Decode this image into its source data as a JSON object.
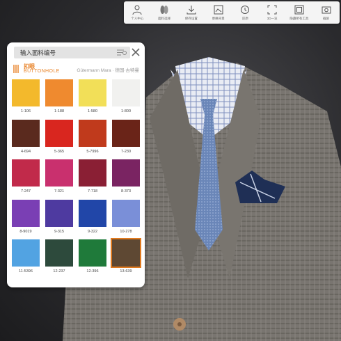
{
  "toolbar": {
    "items": [
      {
        "label": "个人中心",
        "icon": "user-icon"
      },
      {
        "label": "面料选择",
        "icon": "fabric-icon"
      },
      {
        "label": "保存设置",
        "icon": "download-icon"
      },
      {
        "label": "更换背景",
        "icon": "background-icon"
      },
      {
        "label": "还原",
        "icon": "history-icon"
      },
      {
        "label": "3D一览",
        "icon": "fullscreen-icon"
      },
      {
        "label": "隐藏所有工具",
        "icon": "hide-tools-icon"
      },
      {
        "label": "截屏",
        "icon": "camera-icon"
      }
    ]
  },
  "panel": {
    "search_placeholder": "输入面料编号",
    "brand_cn": "扣眼",
    "brand_en": "BUTTONHOLE",
    "brand_right": "Gütermann Mara · 德国·古特曼",
    "accent": "#e8842a",
    "swatches": [
      {
        "code": "1-106",
        "color": "#f3b92c"
      },
      {
        "code": "1-188",
        "color": "#ef8a2f"
      },
      {
        "code": "1-580",
        "color": "#f2df58"
      },
      {
        "code": "1-800",
        "color": "#f1f1ef"
      },
      {
        "code": "4-694",
        "color": "#5a2a1e"
      },
      {
        "code": "5-365",
        "color": "#d9261f"
      },
      {
        "code": "5-7996",
        "color": "#c03a1c"
      },
      {
        "code": "7-230",
        "color": "#6a2418"
      },
      {
        "code": "7-247",
        "color": "#c12a4a"
      },
      {
        "code": "7-321",
        "color": "#c9306e"
      },
      {
        "code": "7-718",
        "color": "#8a1f34"
      },
      {
        "code": "8-373",
        "color": "#7a2462"
      },
      {
        "code": "8-9019",
        "color": "#7a3fb4"
      },
      {
        "code": "9-315",
        "color": "#4e3aa0"
      },
      {
        "code": "9-322",
        "color": "#2146a8"
      },
      {
        "code": "10-278",
        "color": "#7a8fd8"
      },
      {
        "code": "11-5396",
        "color": "#52a3e2"
      },
      {
        "code": "12-237",
        "color": "#2d4a3c"
      },
      {
        "code": "12-396",
        "color": "#1f7a3a"
      },
      {
        "code": "13-639",
        "color": "#5e4833",
        "selected": true
      }
    ]
  }
}
